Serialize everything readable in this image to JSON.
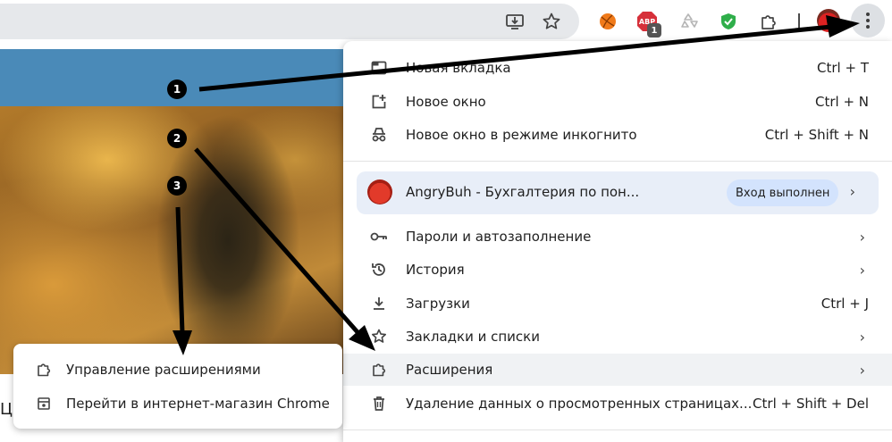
{
  "toolbar": {
    "icons": [
      "install-app-icon",
      "bookmark-star-icon",
      "basketball-extension-icon",
      "abp-extension-icon",
      "recycle-extension-icon",
      "shield-extension-icon",
      "extensions-puzzle-icon",
      "profile-avatar",
      "more-menu-icon"
    ],
    "abp_badge": "1"
  },
  "page": {
    "partial_letter": "Ц"
  },
  "menu": {
    "items": [
      {
        "label": "Новая вкладка",
        "shortcut": "Ctrl + T",
        "icon": "new-tab-icon"
      },
      {
        "label": "Новое окно",
        "shortcut": "Ctrl + N",
        "icon": "new-window-icon"
      },
      {
        "label": "Новое окно в режиме инкогнито",
        "shortcut": "Ctrl + Shift + N",
        "icon": "incognito-icon"
      }
    ],
    "profile": {
      "name": "AngryBuh - Бухгалтерия по пон...",
      "status": "Вход выполнен"
    },
    "items2": [
      {
        "label": "Пароли и автозаполнение",
        "icon": "key-icon"
      },
      {
        "label": "История",
        "icon": "history-icon"
      },
      {
        "label": "Загрузки",
        "shortcut": "Ctrl + J",
        "icon": "download-icon"
      },
      {
        "label": "Закладки и списки",
        "icon": "star-icon"
      },
      {
        "label": "Расширения",
        "icon": "puzzle-icon"
      },
      {
        "label": "Удаление данных о просмотренных страницах...",
        "shortcut": "Ctrl + Shift + Del",
        "icon": "trash-icon"
      }
    ]
  },
  "submenu": {
    "items": [
      {
        "label": "Управление расширениями",
        "icon": "puzzle-icon"
      },
      {
        "label": "Перейти в интернет-магазин Chrome",
        "icon": "web-store-icon"
      }
    ]
  },
  "annotations": {
    "markers": [
      "1",
      "2",
      "3"
    ]
  },
  "colors": {
    "menu_bg": "#ffffff",
    "profile_bg": "#e8eef8",
    "status_chip": "#d3e3fd",
    "highlight": "#f0f2f4",
    "banner": "#4a8ab8"
  }
}
